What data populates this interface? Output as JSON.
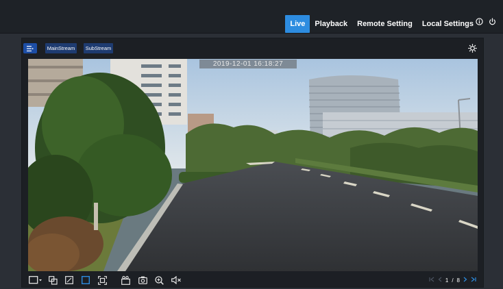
{
  "nav": {
    "items": [
      {
        "label": "Live",
        "active": true
      },
      {
        "label": "Playback",
        "active": false
      },
      {
        "label": "Remote Setting",
        "active": false
      },
      {
        "label": "Local Settings",
        "active": false
      }
    ],
    "icons": [
      "info-icon",
      "power-icon"
    ]
  },
  "toolbar": {
    "menu_icon": "list-menu-icon",
    "main_stream_label": "MainStream",
    "sub_stream_label": "SubStream",
    "brightness_icon": "brightness-icon"
  },
  "video": {
    "timestamp": "2019-12-01 16:18:27"
  },
  "controls": {
    "icons": [
      "layout-select-icon",
      "split-screen-icon",
      "fit-window-icon",
      "original-ratio-icon",
      "fullscreen-icon",
      "record-icon",
      "snapshot-icon",
      "zoom-icon",
      "audio-muted-icon"
    ],
    "active_icon": "original-ratio-icon"
  },
  "pager": {
    "current": "1",
    "separator": "/",
    "total": "8"
  },
  "colors": {
    "accent": "#2d8ce0",
    "topbar": "#1e2227",
    "panel": "#1c1f24",
    "stream_button": "#1e3b70"
  }
}
